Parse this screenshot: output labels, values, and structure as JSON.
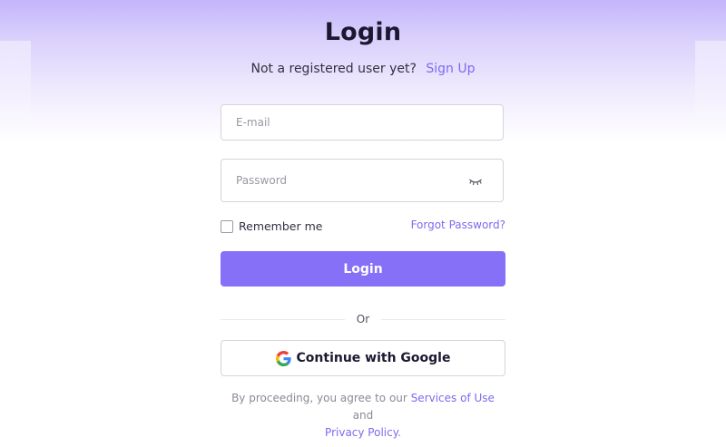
{
  "header": {
    "title": "Login",
    "subtitle_text": "Not a registered user yet?",
    "signup_link": "Sign Up"
  },
  "form": {
    "email": {
      "placeholder": "E-mail",
      "value": ""
    },
    "password": {
      "placeholder": "Password",
      "value": ""
    },
    "remember_label": "Remember me",
    "remember_checked": false,
    "forgot_link": "Forgot Password?",
    "login_button": "Login",
    "divider_text": "Or",
    "google_button": "Continue with Google"
  },
  "terms": {
    "prefix": "By proceeding, you agree to our",
    "services_link": "Services of Use",
    "conjunction": "and",
    "privacy_link": "Privacy Policy",
    "suffix": "."
  },
  "icons": {
    "password_toggle": "eye-closed-icon",
    "google": "google-icon"
  },
  "colors": {
    "accent": "#8570f7",
    "link": "#7b6cf0",
    "header_gradient_top": "#c3b5fb"
  }
}
